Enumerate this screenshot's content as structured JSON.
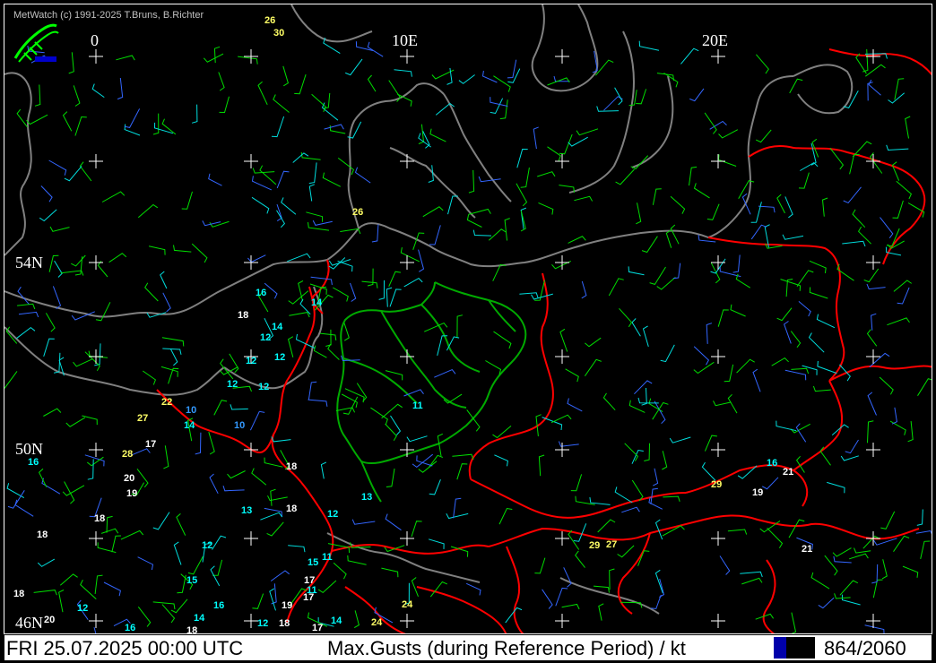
{
  "app": {
    "copyright": "MetWatch  (c) 1991-2025 T.Bruns, B.Richter",
    "logo_icon": "metwatch-logo-icon"
  },
  "map": {
    "longitude_labels": [
      "0",
      "10E",
      "20E"
    ],
    "latitude_labels": [
      "54N",
      "50N",
      "46N"
    ],
    "colors": {
      "coastline": "#808080",
      "border": "#ff0000",
      "region_border": "#00aa00",
      "grid_cross": "#ffffff",
      "barb_green": "#00dd00",
      "barb_blue": "#3366ff",
      "barb_cyan": "#00dddd",
      "label_white": "#ffffff",
      "label_cyan": "#00ffff",
      "label_blue": "#3399ff",
      "label_yellow": "#ffff66"
    },
    "gust_labels": [
      {
        "value": "26",
        "color": "label_yellow"
      },
      {
        "value": "30",
        "color": "label_yellow"
      },
      {
        "value": "26",
        "color": "label_yellow"
      },
      {
        "value": "16",
        "color": "label_cyan"
      },
      {
        "value": "14",
        "color": "label_cyan"
      },
      {
        "value": "18",
        "color": "label_white"
      },
      {
        "value": "14",
        "color": "label_cyan"
      },
      {
        "value": "12",
        "color": "label_cyan"
      },
      {
        "value": "12",
        "color": "label_cyan"
      },
      {
        "value": "12",
        "color": "label_cyan"
      },
      {
        "value": "12",
        "color": "label_cyan"
      },
      {
        "value": "12",
        "color": "label_cyan"
      },
      {
        "value": "22",
        "color": "label_yellow"
      },
      {
        "value": "10",
        "color": "label_blue"
      },
      {
        "value": "27",
        "color": "label_yellow"
      },
      {
        "value": "14",
        "color": "label_cyan"
      },
      {
        "value": "10",
        "color": "label_blue"
      },
      {
        "value": "11",
        "color": "label_cyan"
      },
      {
        "value": "28",
        "color": "label_yellow"
      },
      {
        "value": "17",
        "color": "label_white"
      },
      {
        "value": "16",
        "color": "label_cyan"
      },
      {
        "value": "20",
        "color": "label_white"
      },
      {
        "value": "18",
        "color": "label_white"
      },
      {
        "value": "19",
        "color": "label_white"
      },
      {
        "value": "13",
        "color": "label_cyan"
      },
      {
        "value": "18",
        "color": "label_white"
      },
      {
        "value": "18",
        "color": "label_white"
      },
      {
        "value": "13",
        "color": "label_cyan"
      },
      {
        "value": "12",
        "color": "label_cyan"
      },
      {
        "value": "18",
        "color": "label_white"
      },
      {
        "value": "12",
        "color": "label_cyan"
      },
      {
        "value": "15",
        "color": "label_cyan"
      },
      {
        "value": "11",
        "color": "label_cyan"
      },
      {
        "value": "15",
        "color": "label_cyan"
      },
      {
        "value": "18",
        "color": "label_white"
      },
      {
        "value": "16",
        "color": "label_cyan"
      },
      {
        "value": "12",
        "color": "label_cyan"
      },
      {
        "value": "14",
        "color": "label_cyan"
      },
      {
        "value": "19",
        "color": "label_white"
      },
      {
        "value": "17",
        "color": "label_white"
      },
      {
        "value": "11",
        "color": "label_cyan"
      },
      {
        "value": "17",
        "color": "label_white"
      },
      {
        "value": "20",
        "color": "label_white"
      },
      {
        "value": "16",
        "color": "label_cyan"
      },
      {
        "value": "18",
        "color": "label_white"
      },
      {
        "value": "12",
        "color": "label_cyan"
      },
      {
        "value": "18",
        "color": "label_white"
      },
      {
        "value": "17",
        "color": "label_white"
      },
      {
        "value": "14",
        "color": "label_cyan"
      },
      {
        "value": "24",
        "color": "label_yellow"
      },
      {
        "value": "24",
        "color": "label_yellow"
      },
      {
        "value": "29",
        "color": "label_yellow"
      },
      {
        "value": "27",
        "color": "label_yellow"
      },
      {
        "value": "29",
        "color": "label_yellow"
      },
      {
        "value": "16",
        "color": "label_cyan"
      },
      {
        "value": "21",
        "color": "label_white"
      },
      {
        "value": "19",
        "color": "label_white"
      },
      {
        "value": "21",
        "color": "label_white"
      }
    ]
  },
  "status": {
    "datetime": "FRI 25.07.2025 00:00 UTC",
    "title": "Max.Gusts (during Reference Period) / kt",
    "count": "864/2060"
  }
}
